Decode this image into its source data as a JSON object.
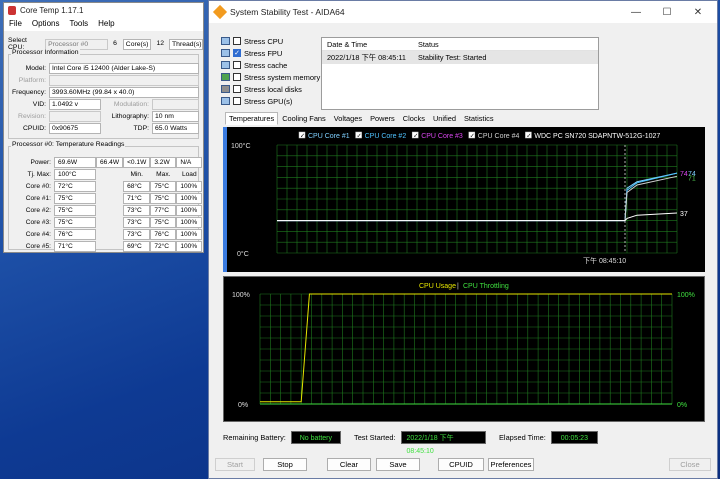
{
  "coretemp": {
    "title": "Core Temp 1.17.1",
    "menu": [
      "File",
      "Options",
      "Tools",
      "Help"
    ],
    "select_cpu_label": "Select CPU:",
    "processor_select": "Processor #0",
    "cores_value": "6",
    "cores_label": "Core(s)",
    "threads_value": "12",
    "threads_label": "Thread(s)",
    "info_title": "Processor Information",
    "model_label": "Model:",
    "model_value": "Intel Core i5 12400 (Alder Lake-S)",
    "platform_label": "Platform:",
    "platform_value": "",
    "frequency_label": "Frequency:",
    "frequency_value": "3993.60MHz (99.84 x 40.0)",
    "vid_label": "VID:",
    "vid_value": "1.0492 v",
    "modulation_label": "Modulation:",
    "modulation_value": "",
    "revision_label": "Revision:",
    "revision_value": "",
    "lithography_label": "Lithography:",
    "lithography_value": "10 nm",
    "cpuid_label": "CPUID:",
    "cpuid_value": "0x90675",
    "tdp_label": "TDP:",
    "tdp_value": "65.0 Watts",
    "readings_title": "Processor #0: Temperature Readings",
    "power_label": "Power:",
    "power_values": [
      "69.6W",
      "66.4W",
      "<0.1W",
      "3.2W",
      "N/A"
    ],
    "tjmax_label": "Tj. Max:",
    "tjmax_value": "100°C",
    "columns": [
      "Min.",
      "Max.",
      "Load"
    ],
    "cores": [
      {
        "name": "Core #0:",
        "temp": "72°C",
        "min": "68°C",
        "max": "75°C",
        "load": "100%"
      },
      {
        "name": "Core #1:",
        "temp": "75°C",
        "min": "71°C",
        "max": "75°C",
        "load": "100%"
      },
      {
        "name": "Core #2:",
        "temp": "75°C",
        "min": "73°C",
        "max": "77°C",
        "load": "100%"
      },
      {
        "name": "Core #3:",
        "temp": "75°C",
        "min": "73°C",
        "max": "75°C",
        "load": "100%"
      },
      {
        "name": "Core #4:",
        "temp": "76°C",
        "min": "73°C",
        "max": "76°C",
        "load": "100%"
      },
      {
        "name": "Core #5:",
        "temp": "71°C",
        "min": "69°C",
        "max": "72°C",
        "load": "100%"
      }
    ]
  },
  "aida": {
    "title": "System Stability Test - AIDA64",
    "stress_items": [
      {
        "label": "Stress CPU",
        "checked": false
      },
      {
        "label": "Stress FPU",
        "checked": true
      },
      {
        "label": "Stress cache",
        "checked": false
      },
      {
        "label": "Stress system memory",
        "checked": false
      },
      {
        "label": "Stress local disks",
        "checked": false
      },
      {
        "label": "Stress GPU(s)",
        "checked": false
      }
    ],
    "status_table": {
      "headers": [
        "Date & Time",
        "Status"
      ],
      "rows": [
        {
          "datetime": "2022/1/18 下午 08:45:11",
          "status": "Stability Test: Started"
        }
      ]
    },
    "tabs": [
      "Temperatures",
      "Cooling Fans",
      "Voltages",
      "Powers",
      "Clocks",
      "Unified",
      "Statistics"
    ],
    "active_tab": "Temperatures",
    "remaining_battery_label": "Remaining Battery:",
    "remaining_battery_value": "No battery",
    "test_started_label": "Test Started:",
    "test_started_value": "2022/1/18 下午 08:45:10",
    "elapsed_label": "Elapsed Time:",
    "elapsed_value": "00:05:23",
    "buttons": {
      "start": "Start",
      "stop": "Stop",
      "clear": "Clear",
      "save": "Save",
      "cpuid": "CPUID",
      "preferences": "Preferences",
      "close": "Close"
    }
  },
  "chart_data": [
    {
      "type": "line",
      "title": "",
      "legend": [
        {
          "name": "CPU Core #1",
          "color": "#7fd0ff",
          "checked": true
        },
        {
          "name": "CPU Core #2",
          "color": "#4fc3ff",
          "checked": true
        },
        {
          "name": "CPU Core #3",
          "color": "#d946ef",
          "checked": true
        },
        {
          "name": "CPU Core #4",
          "color": "#cfcfcf",
          "checked": true
        },
        {
          "name": "WDC PC SN720 SDAPNTW-512G-1027",
          "color": "#ffffff",
          "checked": true
        }
      ],
      "ylim": [
        0,
        100
      ],
      "y_tick_labels": [
        "100°C",
        "0°C"
      ],
      "x_marker_label": "下午 08:45:10",
      "end_labels": [
        "74",
        "74",
        "71",
        "37"
      ],
      "series": [
        {
          "name": "CPU Core #1",
          "x": [
            0,
            0.87,
            0.875,
            0.9,
            1.0
          ],
          "y": [
            30,
            30,
            60,
            66,
            74
          ]
        },
        {
          "name": "CPU Core #2",
          "x": [
            0,
            0.87,
            0.875,
            0.9,
            1.0
          ],
          "y": [
            30,
            30,
            58,
            65,
            74
          ]
        },
        {
          "name": "CPU Core #4",
          "x": [
            0,
            0.87,
            0.875,
            0.9,
            1.0
          ],
          "y": [
            30,
            30,
            56,
            63,
            71
          ]
        },
        {
          "name": "WDC PC SN720 SDAPNTW-512G-1027",
          "x": [
            0,
            0.87,
            0.875,
            0.9,
            1.0
          ],
          "y": [
            30,
            30,
            32,
            35,
            37
          ]
        }
      ],
      "grid": true
    },
    {
      "type": "line",
      "title": "",
      "legend": [
        {
          "name": "CPU Usage",
          "color": "#e6e600"
        },
        {
          "name": "CPU Throttling",
          "color": "#3fe03f"
        }
      ],
      "ylim": [
        0,
        100
      ],
      "y_tick_labels_left": [
        "100%",
        "0%"
      ],
      "y_tick_labels_right": [
        "100%",
        "0%"
      ],
      "series": [
        {
          "name": "CPU Usage",
          "x": [
            0,
            0.1,
            0.12,
            1.0
          ],
          "y": [
            2,
            2,
            100,
            100
          ]
        },
        {
          "name": "CPU Throttling",
          "x": [
            0,
            1.0
          ],
          "y": [
            0,
            0
          ]
        }
      ],
      "grid": true
    }
  ]
}
